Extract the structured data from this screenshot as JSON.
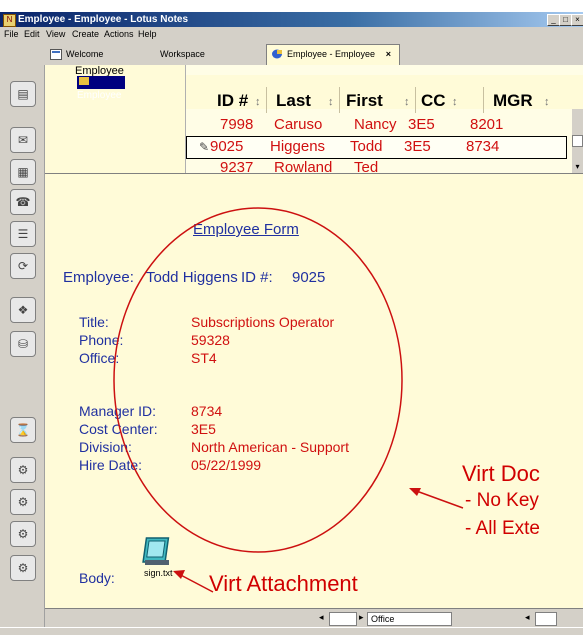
{
  "window": {
    "title": "Employee - Employee - Lotus Notes",
    "min": "_",
    "max": "□",
    "close": "×"
  },
  "menu": [
    "File",
    "Edit",
    "View",
    "Create",
    "Actions",
    "Help"
  ],
  "tabs": [
    {
      "label": "Welcome",
      "active": false
    },
    {
      "label": "Workspace",
      "active": false
    },
    {
      "label": "Employee - Employee",
      "active": true,
      "close": "×"
    }
  ],
  "navpane": {
    "root": "Employee",
    "child": "Employee"
  },
  "view": {
    "columns": [
      "ID #",
      "Last",
      "First",
      "CC",
      "MGR"
    ],
    "sort_glyph": "↕",
    "rows": [
      {
        "id": "7998",
        "last": "Caruso",
        "first": "Nancy",
        "cc": "3E5",
        "mgr": "8201",
        "selected": false
      },
      {
        "id": "9025",
        "last": "Higgens",
        "first": "Todd",
        "cc": "3E5",
        "mgr": "8734",
        "selected": true
      },
      {
        "id": "9237",
        "last": "Rowland",
        "first": "Ted",
        "cc": "",
        "mgr": "",
        "selected": false
      }
    ]
  },
  "form": {
    "title": "Employee Form",
    "employee_label": "Employee:",
    "employee_name": "Todd Higgens",
    "id_label": "ID #:",
    "id_value": "9025",
    "title_label": "Title:",
    "title_value": "Subscriptions Operator",
    "phone_label": "Phone:",
    "phone_value": "59328",
    "office_label": "Office:",
    "office_value": "ST4",
    "manager_label": "Manager ID:",
    "manager_value": "8734",
    "cost_label": "Cost Center:",
    "cost_value": "3E5",
    "division_label": "Division:",
    "division_value": "North American - Support",
    "hire_label": "Hire Date:",
    "hire_value": "05/22/1999",
    "body_label": "Body:",
    "attachment_name": "sign.txt"
  },
  "annotations": {
    "virt_doc": "Virt Doc",
    "no_key": "- No Key",
    "all_ext": "- All Exte",
    "virt_attachment": "Virt Attachment"
  },
  "statusbar": {
    "location": "Office"
  },
  "colors": {
    "field_value": "#d01010",
    "field_label": "#2030a0",
    "annotation": "#d00000",
    "doc_bg": "#fffbd8"
  }
}
